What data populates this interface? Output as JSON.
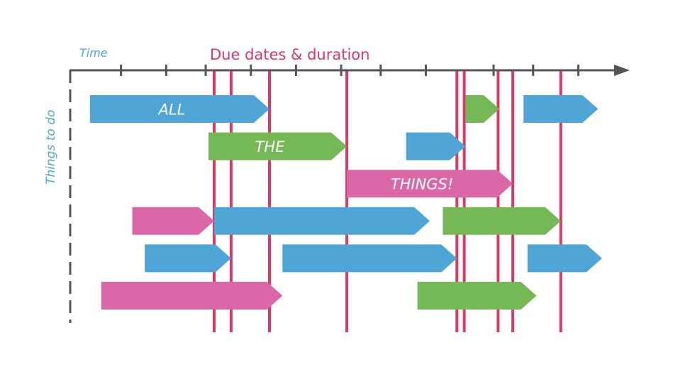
{
  "title": "Due dates & duration",
  "axes": {
    "x_label": "Time",
    "y_label": "Things to do"
  },
  "colors": {
    "axis": "#555555",
    "label_blue": "#4fa7d8",
    "due": "#d93a63",
    "blue": "#4fa6d6",
    "green": "#74b955",
    "pink": "#da67a7"
  },
  "time_range": [
    0,
    100
  ],
  "ticks": [
    9,
    17,
    24,
    32,
    40,
    48,
    55,
    63,
    75,
    82,
    90
  ],
  "due_dates": [
    25.5,
    28.5,
    35.3,
    49,
    68.5,
    69.8,
    75.8,
    78.4,
    86.9
  ],
  "rows": [
    {
      "tasks": [
        {
          "start": 3.5,
          "end": 35.3,
          "color": "blue",
          "label": "ALL"
        },
        {
          "start": 70,
          "end": 76,
          "color": "green",
          "label": ""
        },
        {
          "start": 80.3,
          "end": 93.5,
          "color": "blue",
          "label": ""
        }
      ]
    },
    {
      "tasks": [
        {
          "start": 24.5,
          "end": 49,
          "color": "green",
          "label": "THE"
        },
        {
          "start": 59.5,
          "end": 70,
          "color": "blue",
          "label": ""
        }
      ]
    },
    {
      "tasks": [
        {
          "start": 49,
          "end": 78.4,
          "color": "pink",
          "label": "THINGS!"
        }
      ]
    },
    {
      "tasks": [
        {
          "start": 11,
          "end": 25.5,
          "color": "pink",
          "label": ""
        },
        {
          "start": 25.5,
          "end": 63.7,
          "color": "blue",
          "label": ""
        },
        {
          "start": 66,
          "end": 86.9,
          "color": "green",
          "label": ""
        }
      ]
    },
    {
      "tasks": [
        {
          "start": 13.2,
          "end": 28.5,
          "color": "blue",
          "label": ""
        },
        {
          "start": 37.6,
          "end": 68.5,
          "color": "blue",
          "label": ""
        },
        {
          "start": 81,
          "end": 94.2,
          "color": "blue",
          "label": ""
        }
      ]
    },
    {
      "tasks": [
        {
          "start": 5.5,
          "end": 37.6,
          "color": "pink",
          "label": ""
        },
        {
          "start": 61.5,
          "end": 82.6,
          "color": "green",
          "label": ""
        }
      ]
    }
  ]
}
